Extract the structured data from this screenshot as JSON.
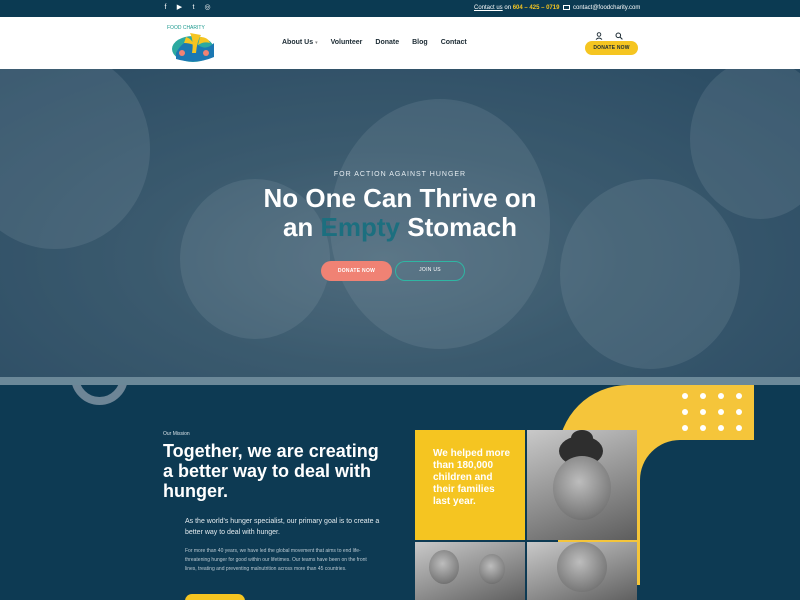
{
  "topbar": {
    "social_icons": [
      "facebook-icon",
      "youtube-icon",
      "twitter-icon",
      "instagram-icon"
    ],
    "contact_link": "Contact us",
    "contact_on": "on",
    "phone": "604 – 425 – 0719",
    "email": "contact@foodcharity.com",
    "bg_color": "#0b3a52",
    "accent_color": "#f5c521"
  },
  "header": {
    "logo_text": "FOOD CHARITY",
    "nav": [
      {
        "label": "About Us"
      },
      {
        "label": "Volunteer"
      },
      {
        "label": "Donate"
      },
      {
        "label": "Blog"
      },
      {
        "label": "Contact"
      }
    ],
    "user_icon": "user-icon",
    "search_icon": "search-icon",
    "donate_button": "DONATE NOW"
  },
  "hero": {
    "kicker": "FOR ACTION AGAINST HUNGER",
    "title_line1": "No One Can Thrive on",
    "title_line2_pre": "an ",
    "title_highlight": "Empty",
    "title_line2_post": " Stomach",
    "primary_button": "DONATE NOW",
    "secondary_button": "JOIN US",
    "primary_color": "#f08274",
    "secondary_border_color": "#2fb6a3"
  },
  "mission": {
    "kicker": "Our Mission",
    "title": "Together, we are creating a better way to deal with hunger.",
    "lead": "As the world's hunger specialist, our primary goal is to create a better way to deal with hunger.",
    "body": "For more than 40 years, we have led the global movement that aims to end life-threatening hunger for good within our lifetimes. Our teams have been on the front lines, treating and preventing malnutrition across more than 45 countries.",
    "stat": "We helped more than 180,000 children and their families last year.",
    "bg_color": "#0d3a53",
    "blob_color": "#f5c53a"
  }
}
